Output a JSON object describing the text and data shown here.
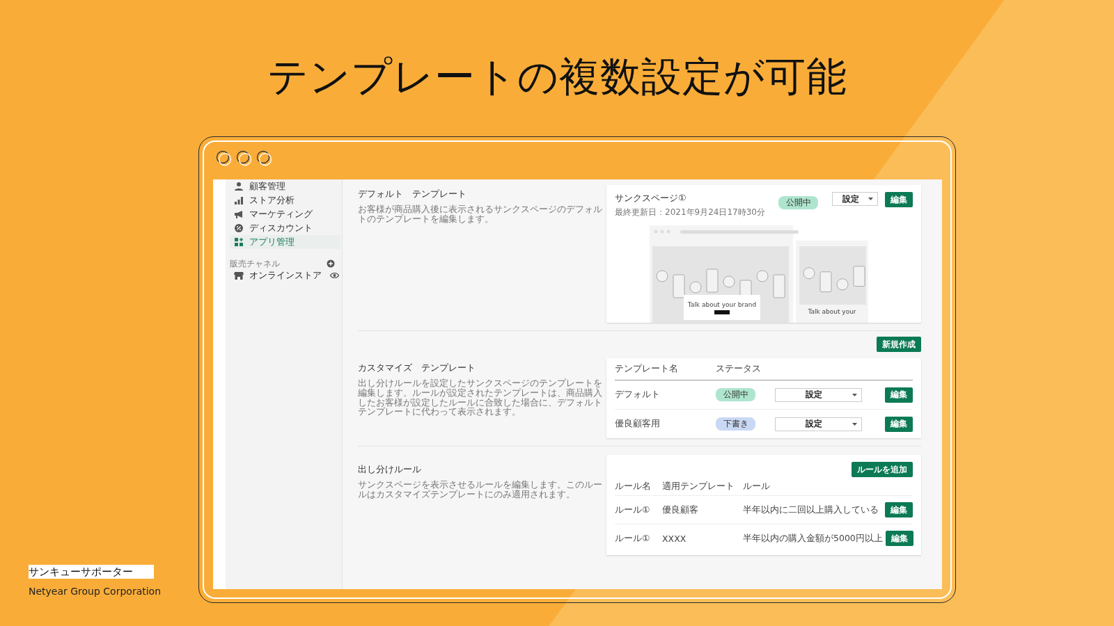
{
  "slide": {
    "title": "テンプレートの複数設定が可能",
    "footer_label": "サンキューサポーター",
    "company": "Netyear Group Corporation"
  },
  "sidebar": {
    "items": [
      {
        "label": "顧客管理",
        "selected": false
      },
      {
        "label": "ストア分析",
        "selected": false
      },
      {
        "label": "マーケティング",
        "selected": false
      },
      {
        "label": "ディスカウント",
        "selected": false
      },
      {
        "label": "アプリ管理",
        "selected": true
      }
    ],
    "channels_heading": "販売チャネル",
    "channels": [
      {
        "label": "オンラインストア"
      }
    ]
  },
  "default_template": {
    "heading": "デフォルト　テンプレート",
    "description": "お客様が商品購入後に表示されるサンクスページのデフォルトのテンプレートを編集します。",
    "page": {
      "title": "サンクスページ①",
      "updated": "最終更新日：2021年9月24日17時30分",
      "status": {
        "label": "公開中",
        "kind": "published"
      },
      "settings": "設定",
      "edit": "編集",
      "preview": {
        "desktop_text": "Talk about your brand",
        "mobile_text": "Talk about your"
      }
    }
  },
  "custom_templates": {
    "new_button": "新規作成",
    "heading": "カスタマイズ　テンプレート",
    "description": "出し分けルールを設定したサンクスページのテンプレートを編集します。ルールが設定されたテンプレートは、商品購入したお客様が設定したルールに合致した場合に、デフォルトテンプレートに代わって表示されます。",
    "columns": [
      "テンプレート名",
      "ステータス"
    ],
    "rows": [
      {
        "name": "デフォルト",
        "status": {
          "label": "公開中",
          "kind": "published"
        },
        "settings": "設定",
        "edit": "編集"
      },
      {
        "name": "優良顧客用",
        "status": {
          "label": "下書き",
          "kind": "draft"
        },
        "settings": "設定",
        "edit": "編集"
      }
    ]
  },
  "rules": {
    "heading": "出し分けルール",
    "description": "サンクスページを表示させるルールを編集します。このルールはカスタマイズテンプレートにのみ適用されます。",
    "add_button": "ルールを追加",
    "columns": [
      "ルール名",
      "適用テンプレート",
      "ルール"
    ],
    "rows": [
      {
        "name": "ルール①",
        "template": "優良顧客",
        "rule": "半年以内に二回以上購入している",
        "edit": "編集"
      },
      {
        "name": "ルール①",
        "template": "XXXX",
        "rule": "半年以内の購入金額が5000円以上",
        "edit": "編集"
      }
    ]
  }
}
